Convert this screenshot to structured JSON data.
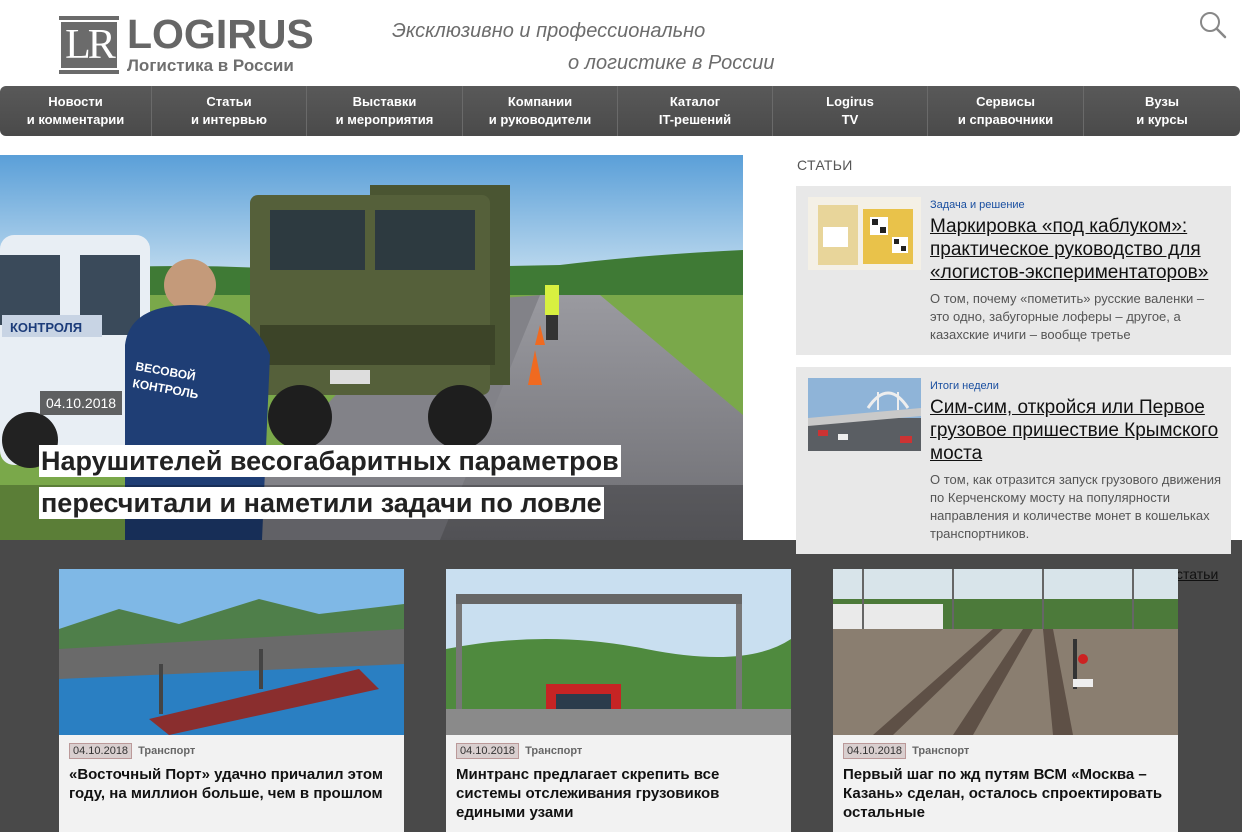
{
  "header": {
    "logo_mark": "LR",
    "logo_name": "LOGIRUS",
    "logo_sub": "Логистика в России",
    "slogan_line1": "Эксклюзивно и профессионально",
    "slogan_line2": "о логистике в России",
    "search_icon": "search-icon"
  },
  "nav": [
    {
      "line1": "Новости",
      "line2": "и комментарии"
    },
    {
      "line1": "Статьи",
      "line2": "и интервью"
    },
    {
      "line1": "Выставки",
      "line2": "и мероприятия"
    },
    {
      "line1": "Компании",
      "line2": "и руководители"
    },
    {
      "line1": "Каталог",
      "line2": "IT-решений"
    },
    {
      "line1": "Logirus",
      "line2": "TV"
    },
    {
      "line1": "Сервисы",
      "line2": "и справочники"
    },
    {
      "line1": "Вузы",
      "line2": "и курсы"
    }
  ],
  "hero": {
    "date": "04.10.2018",
    "title": "Нарушителей весогабаритных параметров пересчитали и наметили задачи по ловле",
    "van_label": "КОНТРОЛЯ",
    "jacket_label": "ВЕСОВОЙ КОНТРОЛЬ"
  },
  "sidebar": {
    "heading": "СТАТЬИ",
    "articles": [
      {
        "category": "Задача и решение",
        "title": "Маркировка «под каблуком»: практическое руководство для «логистов-экспериментаторов»",
        "description": "О том, почему «пометить» русские валенки – это одно, забугорные лоферы – другое, а казахские ичиги – вообще третье"
      },
      {
        "category": "Итоги недели",
        "title": "Сим-сим, откройся или Первое грузовое пришествие Крымского моста",
        "description": "О том, как отразится запуск грузового движения по Керченскому мосту на популярности направления и количестве монет в кошельках транспортников."
      }
    ]
  },
  "all_articles_link": "статьи",
  "cards": [
    {
      "date": "04.10.2018",
      "tag": "Транспорт",
      "title": "«Восточный Порт» удачно причалил этом году, на миллион больше, чем в прошлом"
    },
    {
      "date": "04.10.2018",
      "tag": "Транспорт",
      "title": "Минтранс предлагает скрепить все системы отслеживания грузовиков едиными узами"
    },
    {
      "date": "04.10.2018",
      "tag": "Транспорт",
      "title": "Первый шаг по жд путям ВСМ «Москва – Казань» сделан, осталось спроектировать остальные"
    }
  ],
  "colors": {
    "nav_bg": "#505050",
    "dark_section": "#494949",
    "sidebar_card": "#e8e8e8",
    "link_blue": "#1a4fa0"
  }
}
